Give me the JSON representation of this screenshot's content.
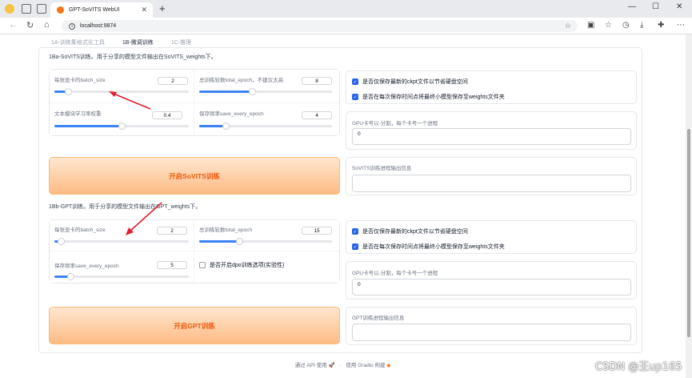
{
  "browser": {
    "tab_title": "GPT-SoVITS WebUI",
    "tab_close": "✕",
    "new_tab": "+",
    "url": "localhost:9874",
    "window_controls": [
      "—",
      "☐",
      "✕"
    ]
  },
  "subtabs": [
    "1A-训练集格式化工具",
    "1B-微调训练",
    "1C-推理"
  ],
  "sovits": {
    "title": "1Ba-SoVITS训练。用于分享的模型文件输出在SoVITS_weights下。",
    "batch_size": {
      "label": "每张显卡的batch_size",
      "value": "2",
      "fraction": 0.1
    },
    "total_epoch": {
      "label": "总训练轮数total_epoch，不建议太高",
      "value": "8",
      "fraction": 0.4
    },
    "text_lr": {
      "label": "文本模块学习率权重",
      "value": "0.4",
      "fraction": 0.5
    },
    "save_every_epoch": {
      "label": "保存频率save_every_epoch",
      "value": "4",
      "fraction": 0.2
    },
    "if_save_latest": {
      "label": "是否仅保存最新的ckpt文件以节省硬盘空间",
      "checked": true
    },
    "if_save_every_weights": {
      "label": "是否在每次保存时间点将最终小模型保存至weights文件夹",
      "checked": true
    },
    "gpu_label": "GPU卡号以-分割，每个卡号一个进程",
    "gpu_value": "0",
    "start_button": "开启SoVITS训练",
    "output_label": "SoVITS训练进程输出信息"
  },
  "gpt": {
    "title": "1Bb-GPT训练。用于分享的模型文件输出在GPT_weights下。",
    "batch_size": {
      "label": "每张显卡的batch_size",
      "value": "2",
      "fraction": 0.05
    },
    "total_epoch": {
      "label": "总训练轮数total_epoch",
      "value": "15",
      "fraction": 0.3
    },
    "save_every_epoch": {
      "label": "保存频率save_every_epoch",
      "value": "5",
      "fraction": 0.12
    },
    "if_dpo": {
      "label": "是否开启dpo训练选项(实验性)",
      "checked": false
    },
    "if_save_latest": {
      "label": "是否仅保存最新的ckpt文件以节省硬盘空间",
      "checked": true
    },
    "if_save_every_weights": {
      "label": "是否在每次保存时间点将最终小模型保存至weights文件夹",
      "checked": true
    },
    "gpu_label": "GPU卡号以-分割，每个卡号一个进程",
    "gpu_value": "0",
    "start_button": "开启GPT训练",
    "output_label": "GPT训练进程输出信息"
  },
  "footer": {
    "api": "通过 API 使用",
    "sep": "·",
    "built": "使用 Gradio 构建"
  },
  "watermark": "CSDN @王up165",
  "colors": {
    "accent": "#f97316",
    "slider": "#3b82f6",
    "checkbox": "#2563eb",
    "arrow": "#e11d2e"
  }
}
